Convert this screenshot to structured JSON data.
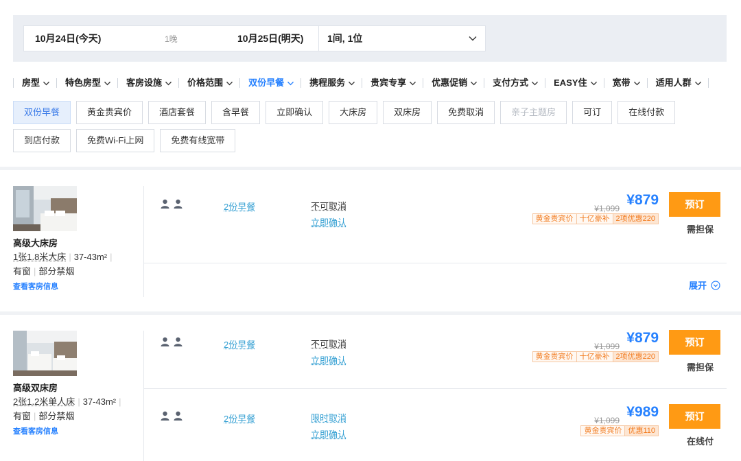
{
  "search": {
    "checkin": "10月24日(今天)",
    "nights": "1晚",
    "checkout": "10月25日(明天)",
    "guests": "1间, 1位"
  },
  "filters": [
    {
      "label": "房型",
      "active": false
    },
    {
      "label": "特色房型",
      "active": false
    },
    {
      "label": "客房设施",
      "active": false
    },
    {
      "label": "价格范围",
      "active": false
    },
    {
      "label": "双份早餐",
      "active": true
    },
    {
      "label": "携程服务",
      "active": false
    },
    {
      "label": "贵宾专享",
      "active": false
    },
    {
      "label": "优惠促销",
      "active": false
    },
    {
      "label": "支付方式",
      "active": false
    },
    {
      "label": "EASY住",
      "active": false
    },
    {
      "label": "宽带",
      "active": false
    },
    {
      "label": "适用人群",
      "active": false
    }
  ],
  "tags": [
    {
      "label": "双份早餐",
      "state": "active"
    },
    {
      "label": "黄金贵宾价",
      "state": "normal"
    },
    {
      "label": "酒店套餐",
      "state": "normal"
    },
    {
      "label": "含早餐",
      "state": "normal"
    },
    {
      "label": "立即确认",
      "state": "normal"
    },
    {
      "label": "大床房",
      "state": "normal"
    },
    {
      "label": "双床房",
      "state": "normal"
    },
    {
      "label": "免费取消",
      "state": "normal"
    },
    {
      "label": "亲子主题房",
      "state": "disabled"
    },
    {
      "label": "可订",
      "state": "normal"
    },
    {
      "label": "在线付款",
      "state": "normal"
    },
    {
      "label": "到店付款",
      "state": "normal"
    },
    {
      "label": "免费Wi-Fi上网",
      "state": "normal"
    },
    {
      "label": "免费有线宽带",
      "state": "normal"
    }
  ],
  "rooms": [
    {
      "name": "高级大床房",
      "bed": "1张1.8米大床",
      "area": "37-43m²",
      "window": "有窗",
      "smoking": "部分禁烟",
      "link": "查看客房信息",
      "rates": [
        {
          "breakfast": "2份早餐",
          "policy": "不可取消",
          "confirm": "立即确认",
          "old_price": "¥1,099",
          "price": "¥879",
          "promos": [
            "黄金贵宾价",
            "十亿豪补",
            "2项优惠220"
          ],
          "book": "预订",
          "note": "需担保"
        }
      ],
      "expand": "展开"
    },
    {
      "name": "高级双床房",
      "bed": "2张1.2米单人床",
      "area": "37-43m²",
      "window": "有窗",
      "smoking": "部分禁烟",
      "link": "查看客房信息",
      "rates": [
        {
          "breakfast": "2份早餐",
          "policy": "不可取消",
          "confirm": "立即确认",
          "old_price": "¥1,099",
          "price": "¥879",
          "promos": [
            "黄金贵宾价",
            "十亿豪补",
            "2项优惠220"
          ],
          "book": "预订",
          "note": "需担保"
        },
        {
          "breakfast": "2份早餐",
          "policy": "限时取消",
          "confirm": "立即确认",
          "old_price": "¥1,099",
          "price": "¥989",
          "promos": [
            "黄金贵宾价",
            "优惠110"
          ],
          "book": "预订",
          "note": "在线付"
        }
      ]
    }
  ],
  "colors": {
    "accent": "#2681ff",
    "book_button": "#ff9a14",
    "promo": "#f27b1f"
  }
}
